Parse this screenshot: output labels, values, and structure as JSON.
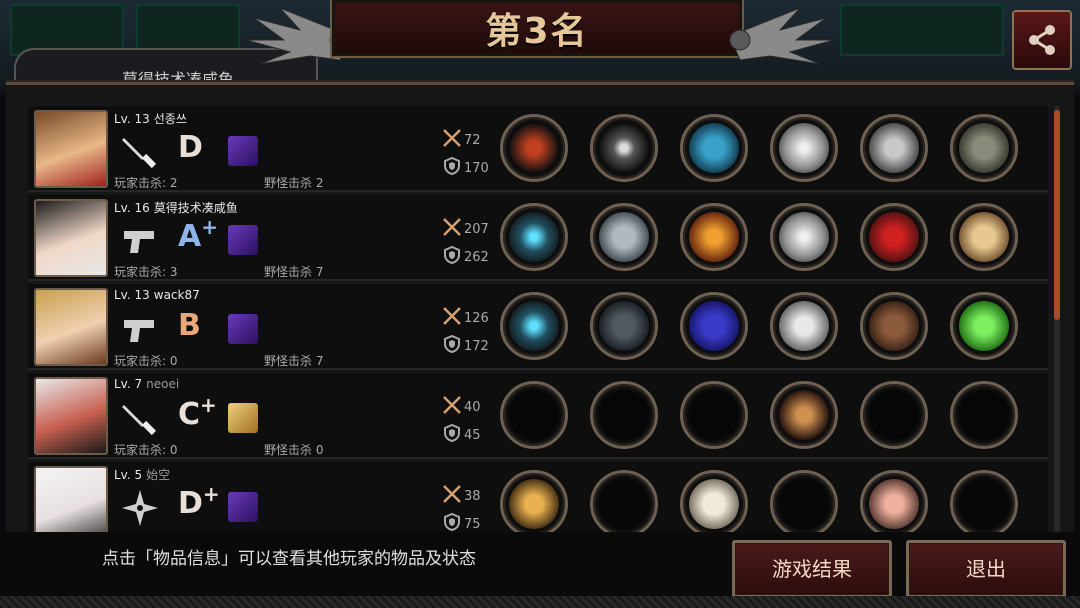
{
  "header": {
    "title": "第3名",
    "behind_tab_text": "莫得技术凑咸鱼"
  },
  "stats_icons": {
    "attack": "crossed-swords-icon",
    "defense": "shield-icon"
  },
  "players": [
    {
      "level": "Lv. 13",
      "name": "선종쓰",
      "name_dim": false,
      "weapon": "knife-icon",
      "grade": "D",
      "grade_plus": "",
      "grade_color": "#e8e0d8",
      "badge": "purple-cube-icon",
      "player_kills": "玩家击杀: 2",
      "monster_kills": "野怪击杀 2",
      "attack": "72",
      "defense": "170",
      "slots": [
        "spear-icon",
        "circlet-icon",
        "blue-armor-icon",
        "metal-disc-icon",
        "chain-leggings-icon",
        "camo-vest-icon"
      ]
    },
    {
      "level": "Lv. 16",
      "name": "莫得技术凑咸鱼",
      "name_dim": false,
      "weapon": "pistol-icon",
      "grade": "A",
      "grade_plus": "+",
      "grade_color": "#8fb4e8",
      "badge": "purple-cube-icon",
      "player_kills": "玩家击杀: 3",
      "monster_kills": "野怪击杀 7",
      "attack": "207",
      "defense": "262",
      "slots": [
        "laser-rifle-icon",
        "steel-helmet-icon",
        "flame-armor-icon",
        "metal-disc-icon",
        "red-heels-icon",
        "fan-icon"
      ]
    },
    {
      "level": "Lv. 13",
      "name": "wack87",
      "name_dim": false,
      "weapon": "pistol-icon",
      "grade": "B",
      "grade_plus": "",
      "grade_color": "#e8a878",
      "badge": "purple-cube-icon",
      "player_kills": "玩家击杀: 0",
      "monster_kills": "野怪击杀 7",
      "attack": "126",
      "defense": "172",
      "slots": [
        "laser-rifle-icon",
        "tactical-helmet-icon",
        "blue-cloak-icon",
        "white-gauntlet-icon",
        "brown-boots-icon",
        "green-gem-icon"
      ]
    },
    {
      "level": "Lv. 7",
      "name": "neoei",
      "name_dim": true,
      "weapon": "knife-icon",
      "grade": "C",
      "grade_plus": "+",
      "grade_color": "#e8e0d8",
      "badge": "gold-box-icon",
      "player_kills": "玩家击杀: 0",
      "monster_kills": "野怪击杀 0",
      "attack": "40",
      "defense": "45",
      "slots": [
        "",
        "",
        "",
        "bracer-icon",
        "",
        ""
      ]
    },
    {
      "level": "Lv. 5",
      "name": "始空",
      "name_dim": true,
      "weapon": "shuriken-icon",
      "grade": "D",
      "grade_plus": "+",
      "grade_color": "#e8e0d8",
      "badge": "purple-cube-icon",
      "player_kills": "",
      "monster_kills": "",
      "attack": "38",
      "defense": "75",
      "slots": [
        "boomerang-icon",
        "",
        "white-robe-icon",
        "",
        "leg-icon",
        ""
      ]
    }
  ],
  "footer": {
    "hint": "点击「物品信息」可以查看其他玩家的物品及状态",
    "result_button": "游戏结果",
    "exit_button": "退出"
  },
  "colors": {
    "accent": "#a94c2a",
    "frame": "#6e6152",
    "button_bg": "#4a1a1a"
  }
}
